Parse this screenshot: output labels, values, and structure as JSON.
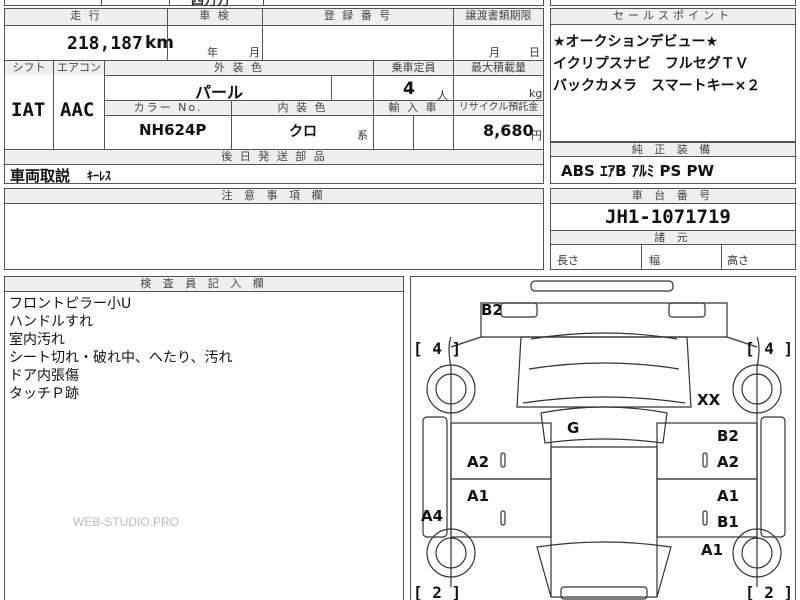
{
  "top_strip": {
    "partial_text": "四万万"
  },
  "main_table": {
    "headers": {
      "mileage": "走 行",
      "inspection": "車 検",
      "registration_no": "登 録 番 号",
      "transfer_deadline": "譲渡書類期限",
      "shift": "シフト",
      "aircon": "エアコン",
      "exterior_color": "外 装 色",
      "capacity": "乗車定員",
      "max_load": "最大積載量",
      "color_no": "カラー No.",
      "interior_color": "内 装 色",
      "import_car": "輸 入 車",
      "recycle_fee": "リサイクル預託金",
      "later_parts": "後 日 発 送 部 品"
    },
    "values": {
      "mileage": "218,187",
      "mileage_unit": "km",
      "inspection_year": "年",
      "inspection_month": "月",
      "transfer_month": "月",
      "transfer_day": "日",
      "shift": "IAT",
      "aircon": "AAC",
      "exterior_color": "パール",
      "capacity": "4",
      "capacity_unit": "人",
      "load_unit": "kg",
      "color_no": "NH624P",
      "interior_color": "クロ",
      "interior_suffix": "系",
      "recycle_fee": "8,680",
      "recycle_unit": "円",
      "later_parts": "車両取説",
      "later_parts_extra": "ｷｰﾚｽ"
    }
  },
  "sales_point": {
    "header": "セールスポイント",
    "lines": [
      "★オークションデビュー★",
      "イクリプスナビ　フルセグＴＶ",
      "バックカメラ　スマートキー×２"
    ]
  },
  "equipment": {
    "header": "純 正 装 備",
    "value": "ABS ｴｱB ｱﾙﾐ PS PW"
  },
  "notes": {
    "header": "注 意 事 項 欄"
  },
  "chassis": {
    "header": "車 台 番 号",
    "value": "JH1-1071719"
  },
  "dimensions": {
    "header": "諸 元",
    "length": "長さ",
    "width": "幅",
    "height": "高さ"
  },
  "inspector": {
    "header": "検 査 員 記 入 欄",
    "lines": [
      "フロントピラー小U",
      "ハンドルすれ",
      "室内汚れ",
      "シート切れ・破れ中、へたり、汚れ",
      "ドア内張傷",
      "タッチＰ跡"
    ],
    "watermark": "WEB-STUDIO.PRO"
  },
  "diagram": {
    "tire_tl": "[ 4 ]",
    "tire_tr": "[ 4 ]",
    "tire_bl": "[ 2 ]",
    "tire_br": "[ 2 ]",
    "marks": {
      "b2_top": "B2",
      "xx": "XX",
      "g": "G",
      "a2_left": "A2",
      "b2_right": "B2",
      "a2_right": "A2",
      "a1_left": "A1",
      "a1_right": "A1",
      "b1_right": "B1",
      "a4_left": "A4",
      "a1_rear": "A1"
    }
  }
}
